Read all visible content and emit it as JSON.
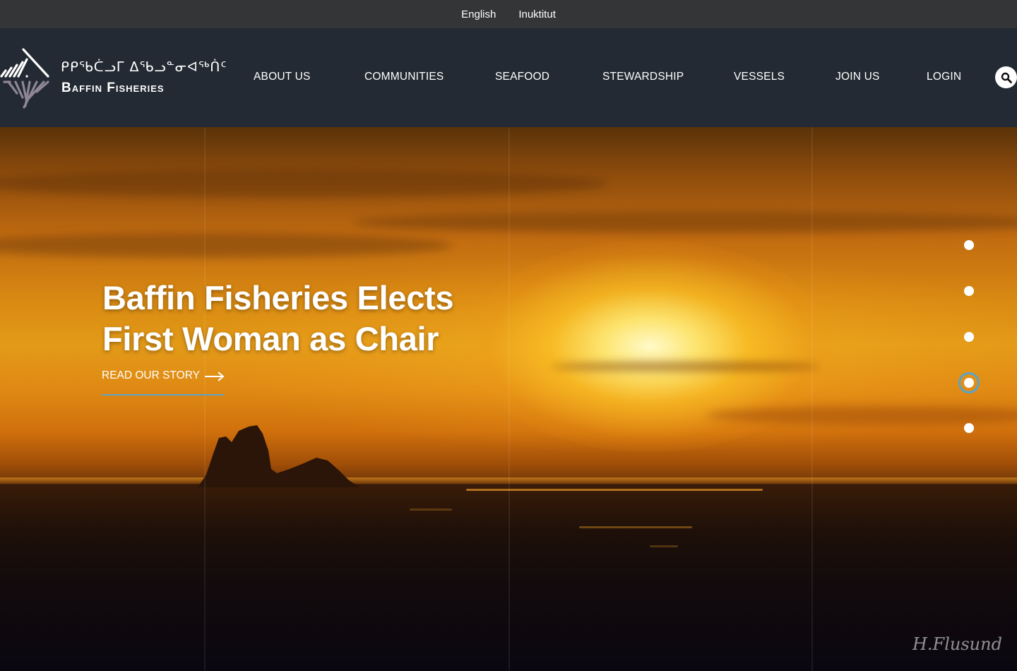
{
  "language_bar": {
    "english": "English",
    "inuktitut": "Inuktitut"
  },
  "header": {
    "logo": {
      "syllabics": "ᑭᑭᖃᑖᓗᒥ ᐃᖃᓗᓐᓂᐊᖅᑏᑦ",
      "name": "Baffin Fisheries"
    },
    "nav": [
      {
        "label": "ABOUT US"
      },
      {
        "label": "COMMUNITIES"
      },
      {
        "label": "SEAFOOD"
      },
      {
        "label": "STEWARDSHIP"
      },
      {
        "label": "VESSELS"
      },
      {
        "label": "JOIN US"
      },
      {
        "label": "LOGIN"
      }
    ],
    "search_icon": "search-icon"
  },
  "hero": {
    "title_line1": "Baffin Fisheries Elects",
    "title_line2": "First Woman as Chair",
    "cta_label": "READ OUR STORY",
    "cta_icon": "arrow-right-icon",
    "slider": {
      "total": 5,
      "active": 4
    },
    "watermark": "H.Flusund"
  },
  "colors": {
    "top_bar": "#333536",
    "header": "#232a33",
    "accent": "#5aa3c9",
    "text": "#ffffff"
  }
}
